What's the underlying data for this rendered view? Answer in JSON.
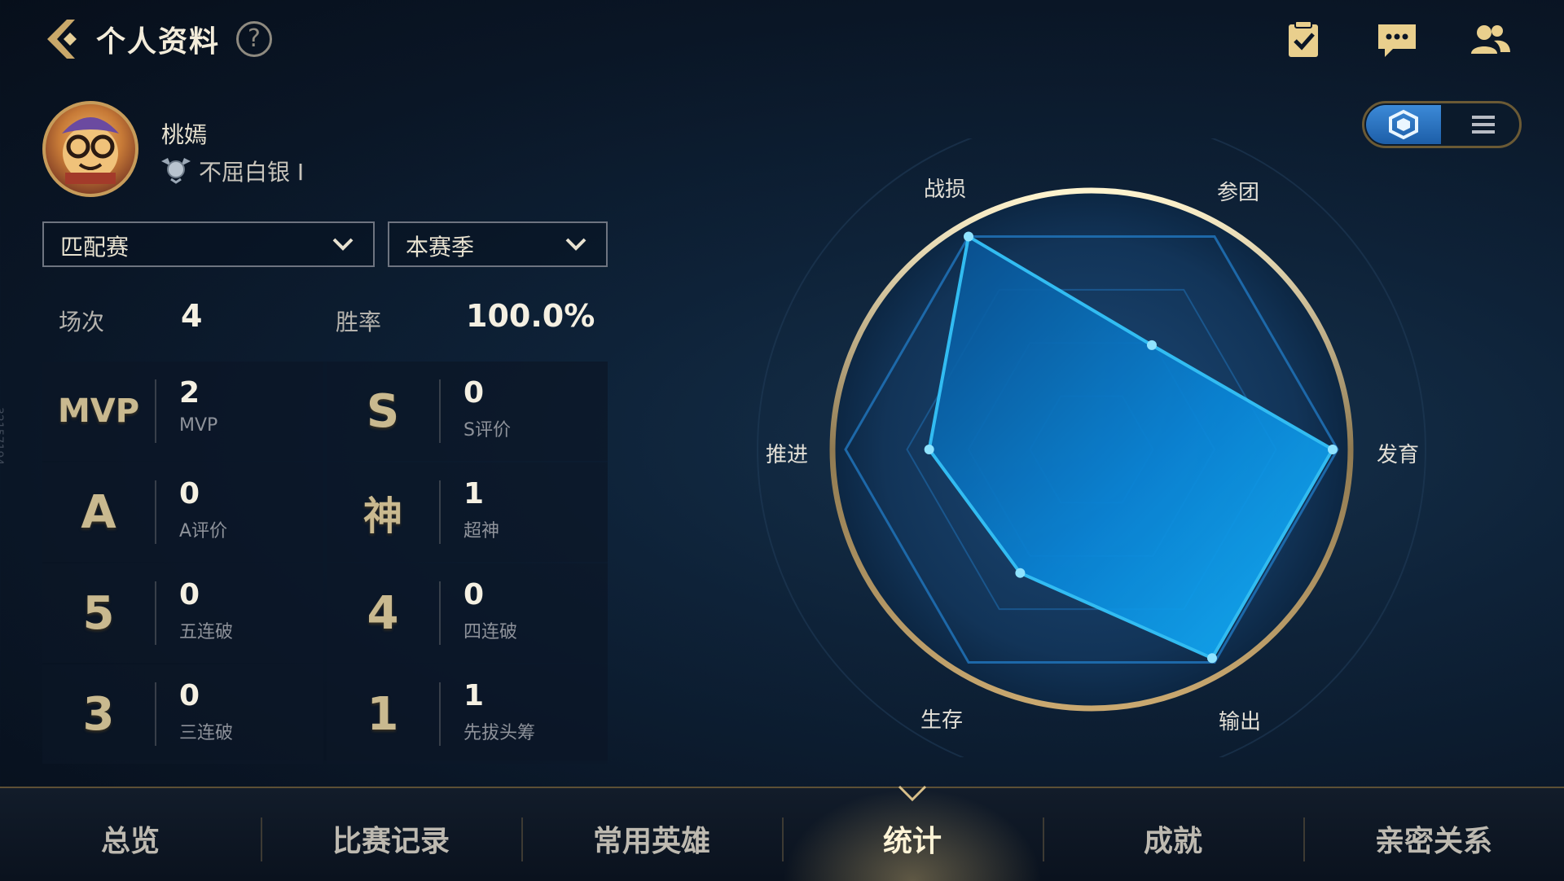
{
  "header": {
    "title": "个人资料",
    "help_label": "?"
  },
  "profile": {
    "username": "桃嫣",
    "rank": "不屈白银 Ⅰ"
  },
  "filters": {
    "mode": "匹配赛",
    "season": "本赛季"
  },
  "summary": {
    "games_label": "场次",
    "games_value": "4",
    "winrate_label": "胜率",
    "winrate_value": "100.0%"
  },
  "stats": [
    {
      "badge": "MVP",
      "value": "2",
      "caption": "MVP"
    },
    {
      "badge": "S",
      "value": "0",
      "caption": "S评价"
    },
    {
      "badge": "A",
      "value": "0",
      "caption": "A评价"
    },
    {
      "badge": "神",
      "value": "1",
      "caption": "超神"
    },
    {
      "badge": "5",
      "value": "0",
      "caption": "五连破"
    },
    {
      "badge": "4",
      "value": "0",
      "caption": "四连破"
    },
    {
      "badge": "3",
      "value": "0",
      "caption": "三连破"
    },
    {
      "badge": "1",
      "value": "1",
      "caption": "先拔头筹"
    }
  ],
  "radar": {
    "axes": [
      "战损",
      "参团",
      "发育",
      "输出",
      "生存",
      "推进"
    ],
    "values": [
      1.0,
      0.49,
      0.98,
      0.98,
      0.58,
      0.66
    ],
    "accent": "#35c8ff"
  },
  "tabs": [
    "总览",
    "比赛记录",
    "常用英雄",
    "统计",
    "成就",
    "亲密关系"
  ],
  "active_tab": "统计",
  "side_id": "32157194"
}
